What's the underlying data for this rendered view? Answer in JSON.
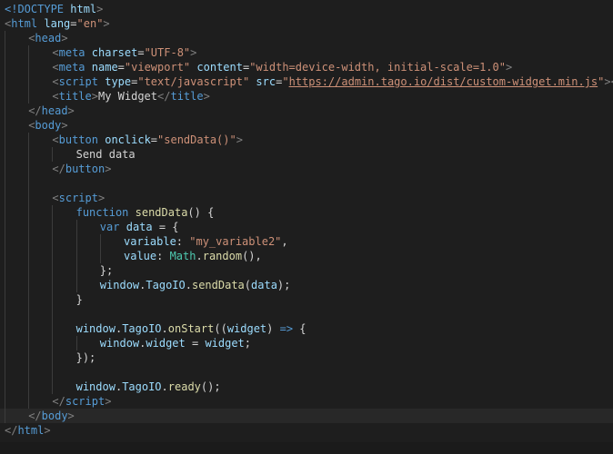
{
  "editor": {
    "language": "html",
    "current_line": 28,
    "colors": {
      "background": "#1e1e1e",
      "current_line_background": "#282828",
      "tag": "#569cd6",
      "attribute": "#9cdcfe",
      "string": "#ce9178",
      "function": "#dcdcaa",
      "class": "#4ec9b0",
      "text": "#d4d4d4"
    },
    "lines": [
      {
        "indent": 0,
        "tokens": [
          [
            "doctype",
            "<!DOCTYPE "
          ],
          [
            "doctype-name",
            "html"
          ],
          [
            "bracket",
            ">"
          ]
        ]
      },
      {
        "indent": 0,
        "tokens": [
          [
            "bracket",
            "<"
          ],
          [
            "tag",
            "html"
          ],
          [
            "text",
            " "
          ],
          [
            "attr",
            "lang"
          ],
          [
            "text",
            "="
          ],
          [
            "str",
            "\"en\""
          ],
          [
            "bracket",
            ">"
          ]
        ]
      },
      {
        "indent": 1,
        "tokens": [
          [
            "bracket",
            "<"
          ],
          [
            "tag",
            "head"
          ],
          [
            "bracket",
            ">"
          ]
        ]
      },
      {
        "indent": 2,
        "tokens": [
          [
            "bracket",
            "<"
          ],
          [
            "tag",
            "meta"
          ],
          [
            "text",
            " "
          ],
          [
            "attr",
            "charset"
          ],
          [
            "text",
            "="
          ],
          [
            "str",
            "\"UTF-8\""
          ],
          [
            "bracket",
            ">"
          ]
        ]
      },
      {
        "indent": 2,
        "tokens": [
          [
            "bracket",
            "<"
          ],
          [
            "tag",
            "meta"
          ],
          [
            "text",
            " "
          ],
          [
            "attr",
            "name"
          ],
          [
            "text",
            "="
          ],
          [
            "str",
            "\"viewport\""
          ],
          [
            "text",
            " "
          ],
          [
            "attr",
            "content"
          ],
          [
            "text",
            "="
          ],
          [
            "str",
            "\"width=device-width, initial-scale=1.0\""
          ],
          [
            "bracket",
            ">"
          ]
        ]
      },
      {
        "indent": 2,
        "tokens": [
          [
            "bracket",
            "<"
          ],
          [
            "tag",
            "script"
          ],
          [
            "text",
            " "
          ],
          [
            "attr",
            "type"
          ],
          [
            "text",
            "="
          ],
          [
            "str",
            "\"text/javascript\""
          ],
          [
            "text",
            " "
          ],
          [
            "attr",
            "src"
          ],
          [
            "text",
            "="
          ],
          [
            "str",
            "\""
          ],
          [
            "url",
            "https://admin.tago.io/dist/custom-widget.min.js"
          ],
          [
            "str",
            "\""
          ],
          [
            "bracket",
            "></"
          ],
          [
            "tag",
            "script"
          ],
          [
            "bracket",
            ">"
          ]
        ]
      },
      {
        "indent": 2,
        "tokens": [
          [
            "bracket",
            "<"
          ],
          [
            "tag",
            "title"
          ],
          [
            "bracket",
            ">"
          ],
          [
            "text",
            "My Widget"
          ],
          [
            "bracket",
            "</"
          ],
          [
            "tag",
            "title"
          ],
          [
            "bracket",
            ">"
          ]
        ]
      },
      {
        "indent": 1,
        "tokens": [
          [
            "bracket",
            "</"
          ],
          [
            "tag",
            "head"
          ],
          [
            "bracket",
            ">"
          ]
        ]
      },
      {
        "indent": 1,
        "tokens": [
          [
            "bracket",
            "<"
          ],
          [
            "tag",
            "body"
          ],
          [
            "bracket",
            ">"
          ]
        ]
      },
      {
        "indent": 2,
        "tokens": [
          [
            "bracket",
            "<"
          ],
          [
            "tag",
            "button"
          ],
          [
            "text",
            " "
          ],
          [
            "attr",
            "onclick"
          ],
          [
            "text",
            "="
          ],
          [
            "str",
            "\"sendData()\""
          ],
          [
            "bracket",
            ">"
          ]
        ]
      },
      {
        "indent": 3,
        "tokens": [
          [
            "text",
            "Send data"
          ]
        ]
      },
      {
        "indent": 2,
        "tokens": [
          [
            "bracket",
            "</"
          ],
          [
            "tag",
            "button"
          ],
          [
            "bracket",
            ">"
          ]
        ]
      },
      {
        "indent": 2,
        "tokens": []
      },
      {
        "indent": 2,
        "tokens": [
          [
            "bracket",
            "<"
          ],
          [
            "tag",
            "script"
          ],
          [
            "bracket",
            ">"
          ]
        ]
      },
      {
        "indent": 3,
        "tokens": [
          [
            "kw",
            "function"
          ],
          [
            "text",
            " "
          ],
          [
            "fn",
            "sendData"
          ],
          [
            "punct",
            "() {"
          ]
        ]
      },
      {
        "indent": 4,
        "tokens": [
          [
            "kw",
            "var"
          ],
          [
            "text",
            " "
          ],
          [
            "var",
            "data"
          ],
          [
            "punct",
            " = {"
          ]
        ]
      },
      {
        "indent": 5,
        "tokens": [
          [
            "var",
            "variable"
          ],
          [
            "punct",
            ": "
          ],
          [
            "str",
            "\"my_variable2\""
          ],
          [
            "punct",
            ","
          ]
        ]
      },
      {
        "indent": 5,
        "tokens": [
          [
            "var",
            "value"
          ],
          [
            "punct",
            ": "
          ],
          [
            "cls",
            "Math"
          ],
          [
            "punct",
            "."
          ],
          [
            "fn",
            "random"
          ],
          [
            "punct",
            "(),"
          ]
        ]
      },
      {
        "indent": 4,
        "tokens": [
          [
            "punct",
            "};"
          ]
        ]
      },
      {
        "indent": 4,
        "tokens": [
          [
            "var",
            "window"
          ],
          [
            "punct",
            "."
          ],
          [
            "var",
            "TagoIO"
          ],
          [
            "punct",
            "."
          ],
          [
            "fn",
            "sendData"
          ],
          [
            "punct",
            "("
          ],
          [
            "var",
            "data"
          ],
          [
            "punct",
            ");"
          ]
        ]
      },
      {
        "indent": 3,
        "tokens": [
          [
            "punct",
            "}"
          ]
        ]
      },
      {
        "indent": 3,
        "tokens": []
      },
      {
        "indent": 3,
        "tokens": [
          [
            "var",
            "window"
          ],
          [
            "punct",
            "."
          ],
          [
            "var",
            "TagoIO"
          ],
          [
            "punct",
            "."
          ],
          [
            "fn",
            "onStart"
          ],
          [
            "punct",
            "(("
          ],
          [
            "var",
            "widget"
          ],
          [
            "punct",
            ") "
          ],
          [
            "kw",
            "=>"
          ],
          [
            "punct",
            " {"
          ]
        ]
      },
      {
        "indent": 4,
        "tokens": [
          [
            "var",
            "window"
          ],
          [
            "punct",
            "."
          ],
          [
            "var",
            "widget"
          ],
          [
            "punct",
            " = "
          ],
          [
            "var",
            "widget"
          ],
          [
            "punct",
            ";"
          ]
        ]
      },
      {
        "indent": 3,
        "tokens": [
          [
            "punct",
            "});"
          ]
        ]
      },
      {
        "indent": 3,
        "tokens": []
      },
      {
        "indent": 3,
        "tokens": [
          [
            "var",
            "window"
          ],
          [
            "punct",
            "."
          ],
          [
            "var",
            "TagoIO"
          ],
          [
            "punct",
            "."
          ],
          [
            "fn",
            "ready"
          ],
          [
            "punct",
            "();"
          ]
        ]
      },
      {
        "indent": 2,
        "tokens": [
          [
            "bracket",
            "</"
          ],
          [
            "tag",
            "script"
          ],
          [
            "bracket",
            ">"
          ]
        ]
      },
      {
        "indent": 1,
        "tokens": [
          [
            "bracket",
            "</"
          ],
          [
            "tag",
            "body"
          ],
          [
            "bracket",
            ">"
          ]
        ]
      },
      {
        "indent": 0,
        "tokens": [
          [
            "bracket",
            "</"
          ],
          [
            "tag",
            "html"
          ],
          [
            "bracket",
            ">"
          ]
        ]
      }
    ]
  }
}
